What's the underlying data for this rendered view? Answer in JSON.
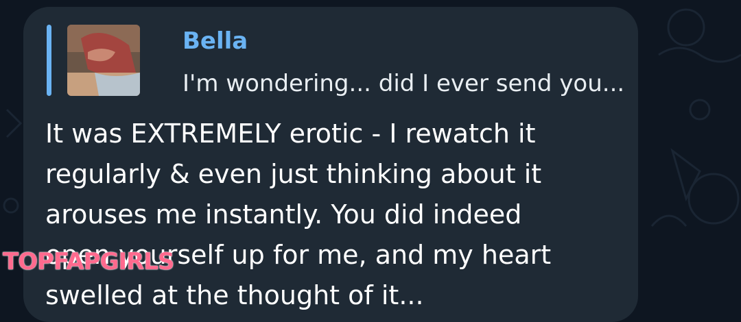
{
  "reply": {
    "sender": "Bella",
    "preview": "I'm wondering... did I ever send you..."
  },
  "message": {
    "lines": [
      "It was EXTREMELY erotic - I rewatch it",
      "regularly & even just thinking about it",
      "arouses me instantly. You did indeed",
      "open yourself up for me, and my heart",
      "swelled at the thought of it..."
    ]
  },
  "watermark": "TOPFAPGIRLS",
  "colors": {
    "background": "#0e1621",
    "bubble": "#1f2a35",
    "accent": "#6ab3f3",
    "text": "#ffffff",
    "watermark": "#ff6a8e"
  }
}
